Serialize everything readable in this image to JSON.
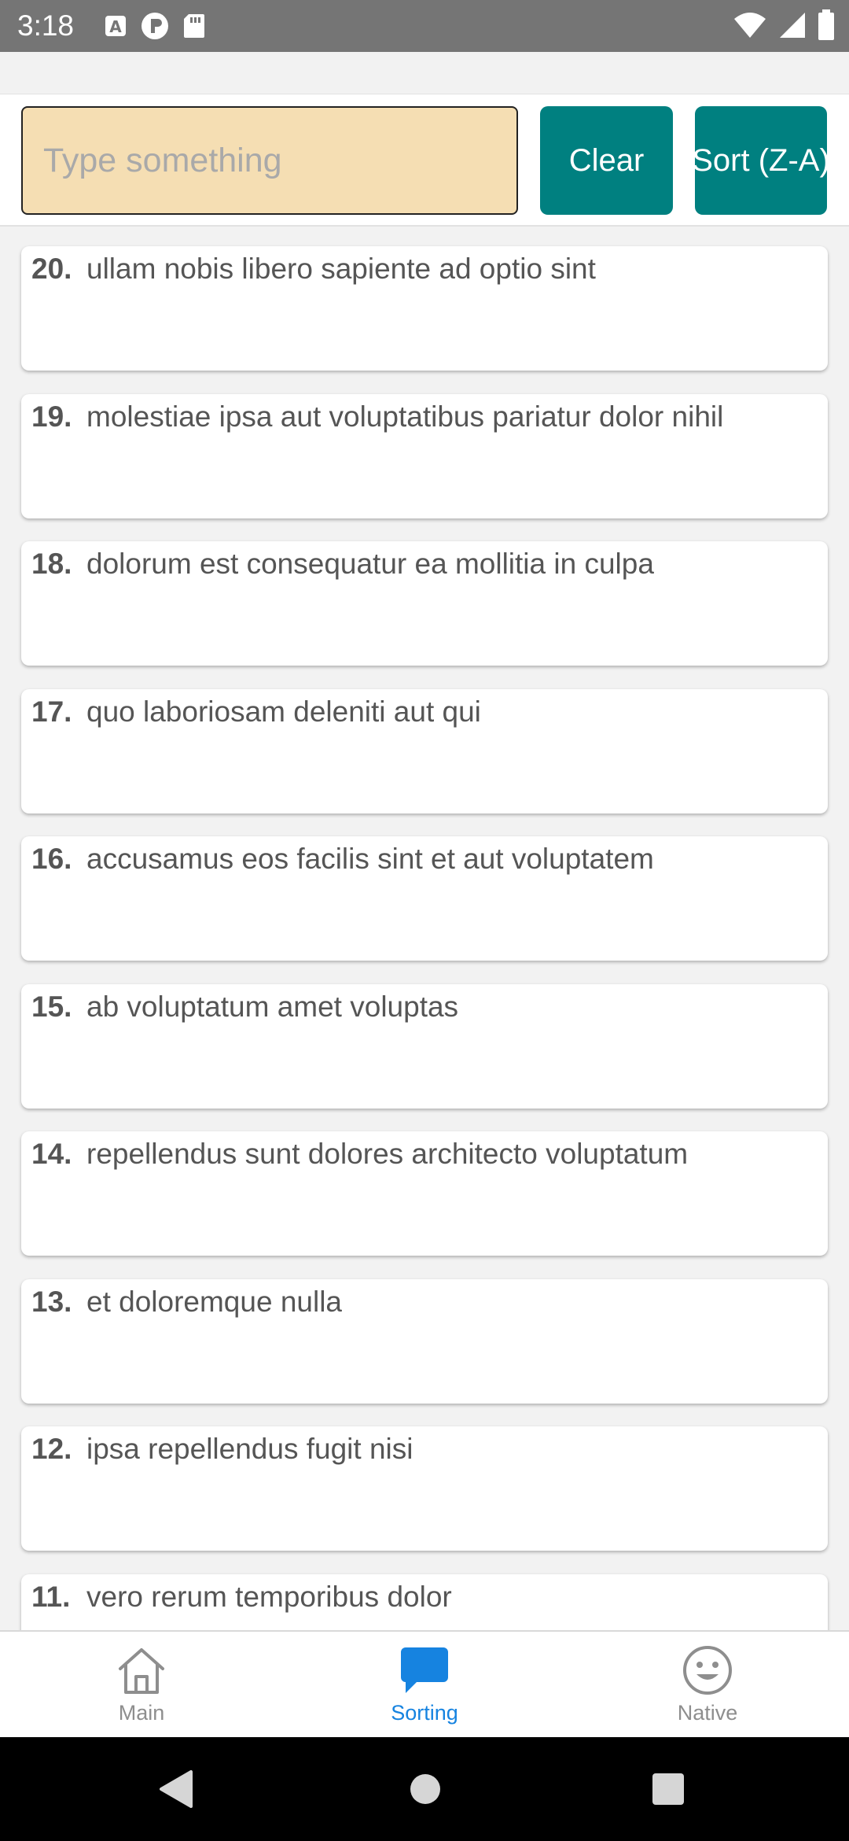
{
  "status_bar": {
    "time": "3:18",
    "left_icons": [
      "a-box-icon",
      "circle-p-icon",
      "sd-card-icon"
    ],
    "right_icons": [
      "wifi-icon",
      "signal-icon",
      "battery-icon"
    ]
  },
  "controls": {
    "input_value": "",
    "input_placeholder": "Type something",
    "clear_label": "Clear",
    "sort_label": "Sort (Z-A)",
    "input_bg": "#f5deb3",
    "button_bg": "#008080"
  },
  "list": {
    "items": [
      {
        "index": "20.",
        "text": "ullam nobis libero sapiente ad optio sint"
      },
      {
        "index": "19.",
        "text": "molestiae ipsa aut voluptatibus pariatur dolor nihil"
      },
      {
        "index": "18.",
        "text": "dolorum est consequatur ea mollitia in culpa"
      },
      {
        "index": "17.",
        "text": "quo laboriosam deleniti aut qui"
      },
      {
        "index": "16.",
        "text": "accusamus eos facilis sint et aut voluptatem"
      },
      {
        "index": "15.",
        "text": "ab voluptatum amet voluptas"
      },
      {
        "index": "14.",
        "text": "repellendus sunt dolores architecto voluptatum"
      },
      {
        "index": "13.",
        "text": "et doloremque nulla"
      },
      {
        "index": "12.",
        "text": "ipsa repellendus fugit nisi"
      },
      {
        "index": "11.",
        "text": "vero rerum temporibus dolor"
      }
    ]
  },
  "tabs": [
    {
      "label": "Main",
      "icon": "home-icon",
      "active": false
    },
    {
      "label": "Sorting",
      "icon": "chat-bubble-icon",
      "active": true
    },
    {
      "label": "Native",
      "icon": "smiley-icon",
      "active": false
    }
  ],
  "colors": {
    "active_tab": "#1683e0",
    "inactive_tab": "#8e8e8e"
  },
  "nav_bar": {
    "icons": [
      "back-triangle-icon",
      "home-circle-icon",
      "recents-square-icon"
    ]
  }
}
